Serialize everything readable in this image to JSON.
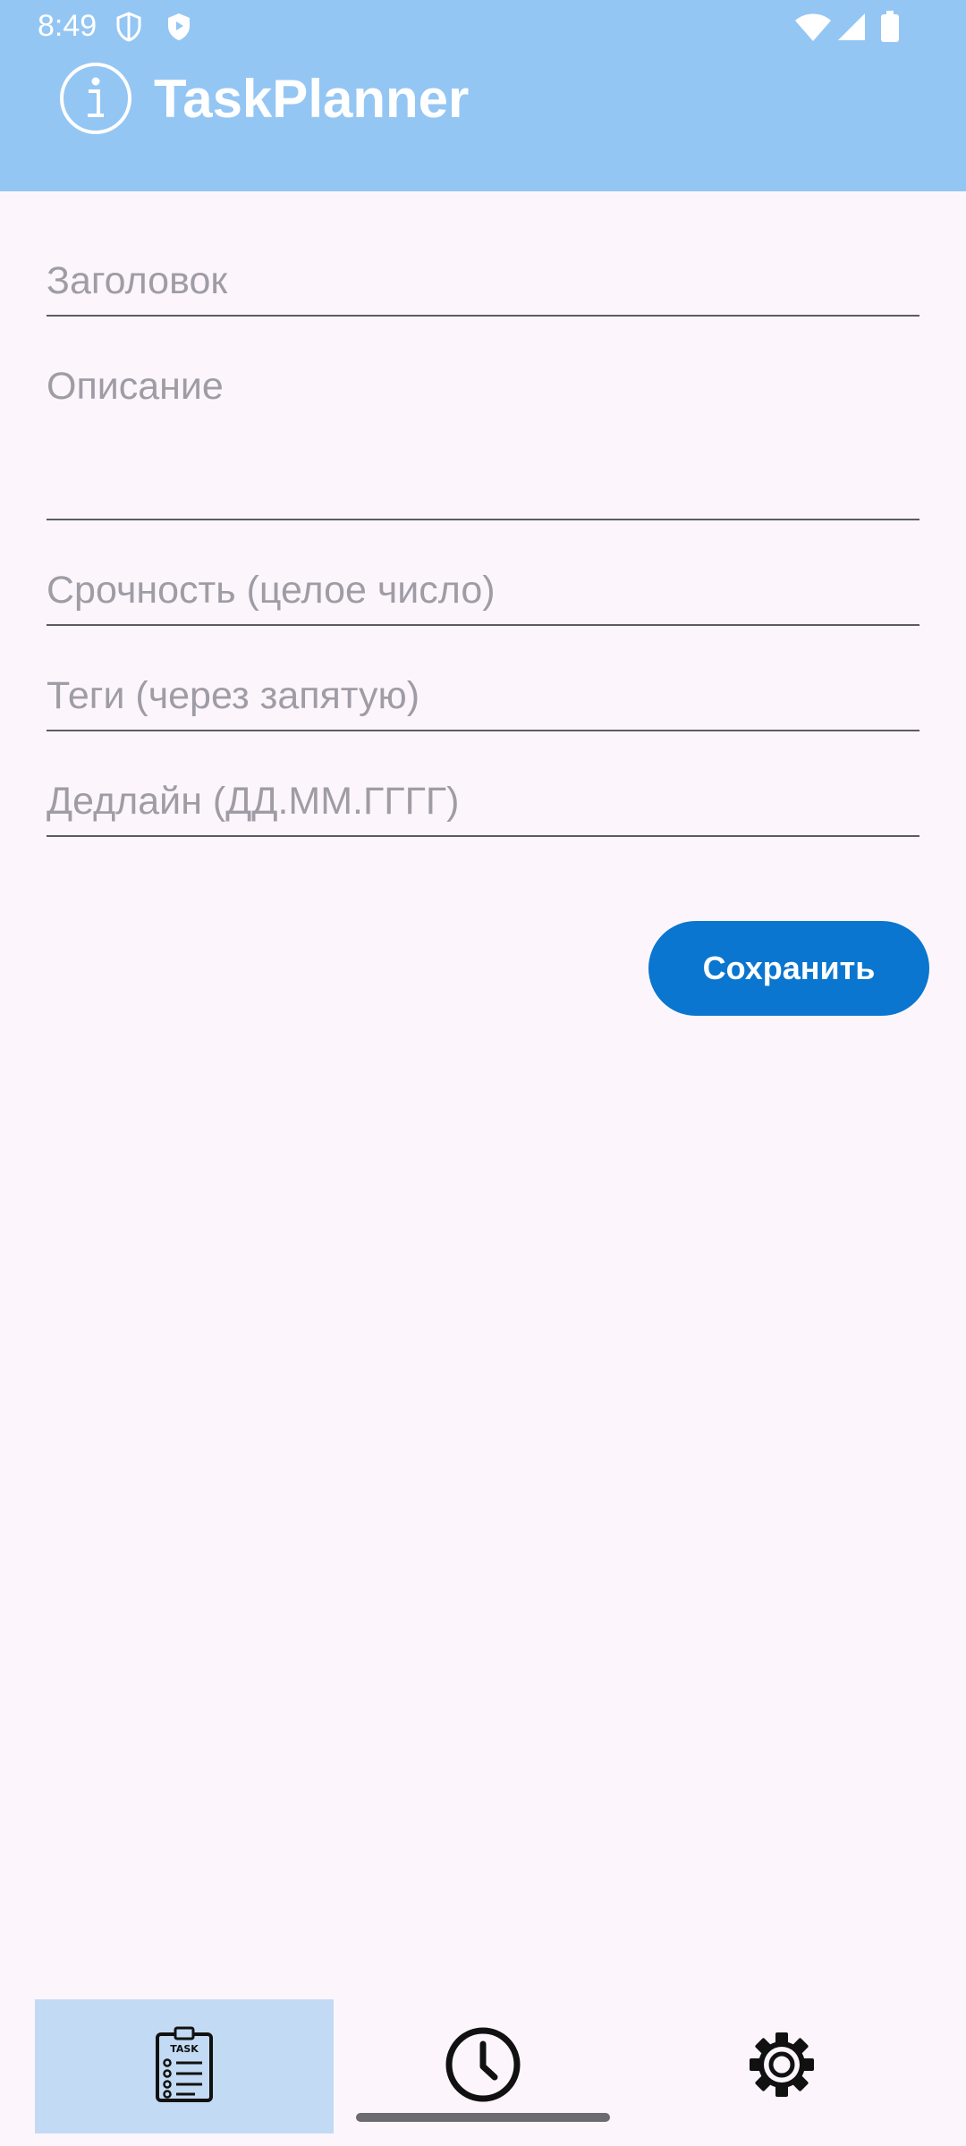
{
  "status_bar": {
    "time": "8:49",
    "left_icons": [
      "shield-icon",
      "play-shield-icon"
    ],
    "right_icons": [
      "wifi-icon",
      "signal-icon",
      "battery-icon"
    ]
  },
  "app_bar": {
    "title": "TaskPlanner",
    "icon": "info-icon",
    "background_color": "#94c6f4"
  },
  "form": {
    "title_field": {
      "value": "",
      "placeholder": "Заголовок"
    },
    "description_field": {
      "value": "",
      "placeholder": "Описание"
    },
    "urgency_field": {
      "value": "",
      "placeholder": "Срочность (целое число)"
    },
    "tags_field": {
      "value": "",
      "placeholder": "Теги (через запятую)"
    },
    "deadline_field": {
      "value": "",
      "placeholder": "Дедлайн (ДД.ММ.ГГГГ)"
    }
  },
  "actions": {
    "save_label": "Сохранить",
    "save_color": "#0a76cf"
  },
  "bottom_nav": {
    "items": [
      {
        "icon": "task-list-icon",
        "selected": true
      },
      {
        "icon": "clock-icon",
        "selected": false
      },
      {
        "icon": "gear-icon",
        "selected": false
      }
    ],
    "active_background": "#c3daf4"
  }
}
